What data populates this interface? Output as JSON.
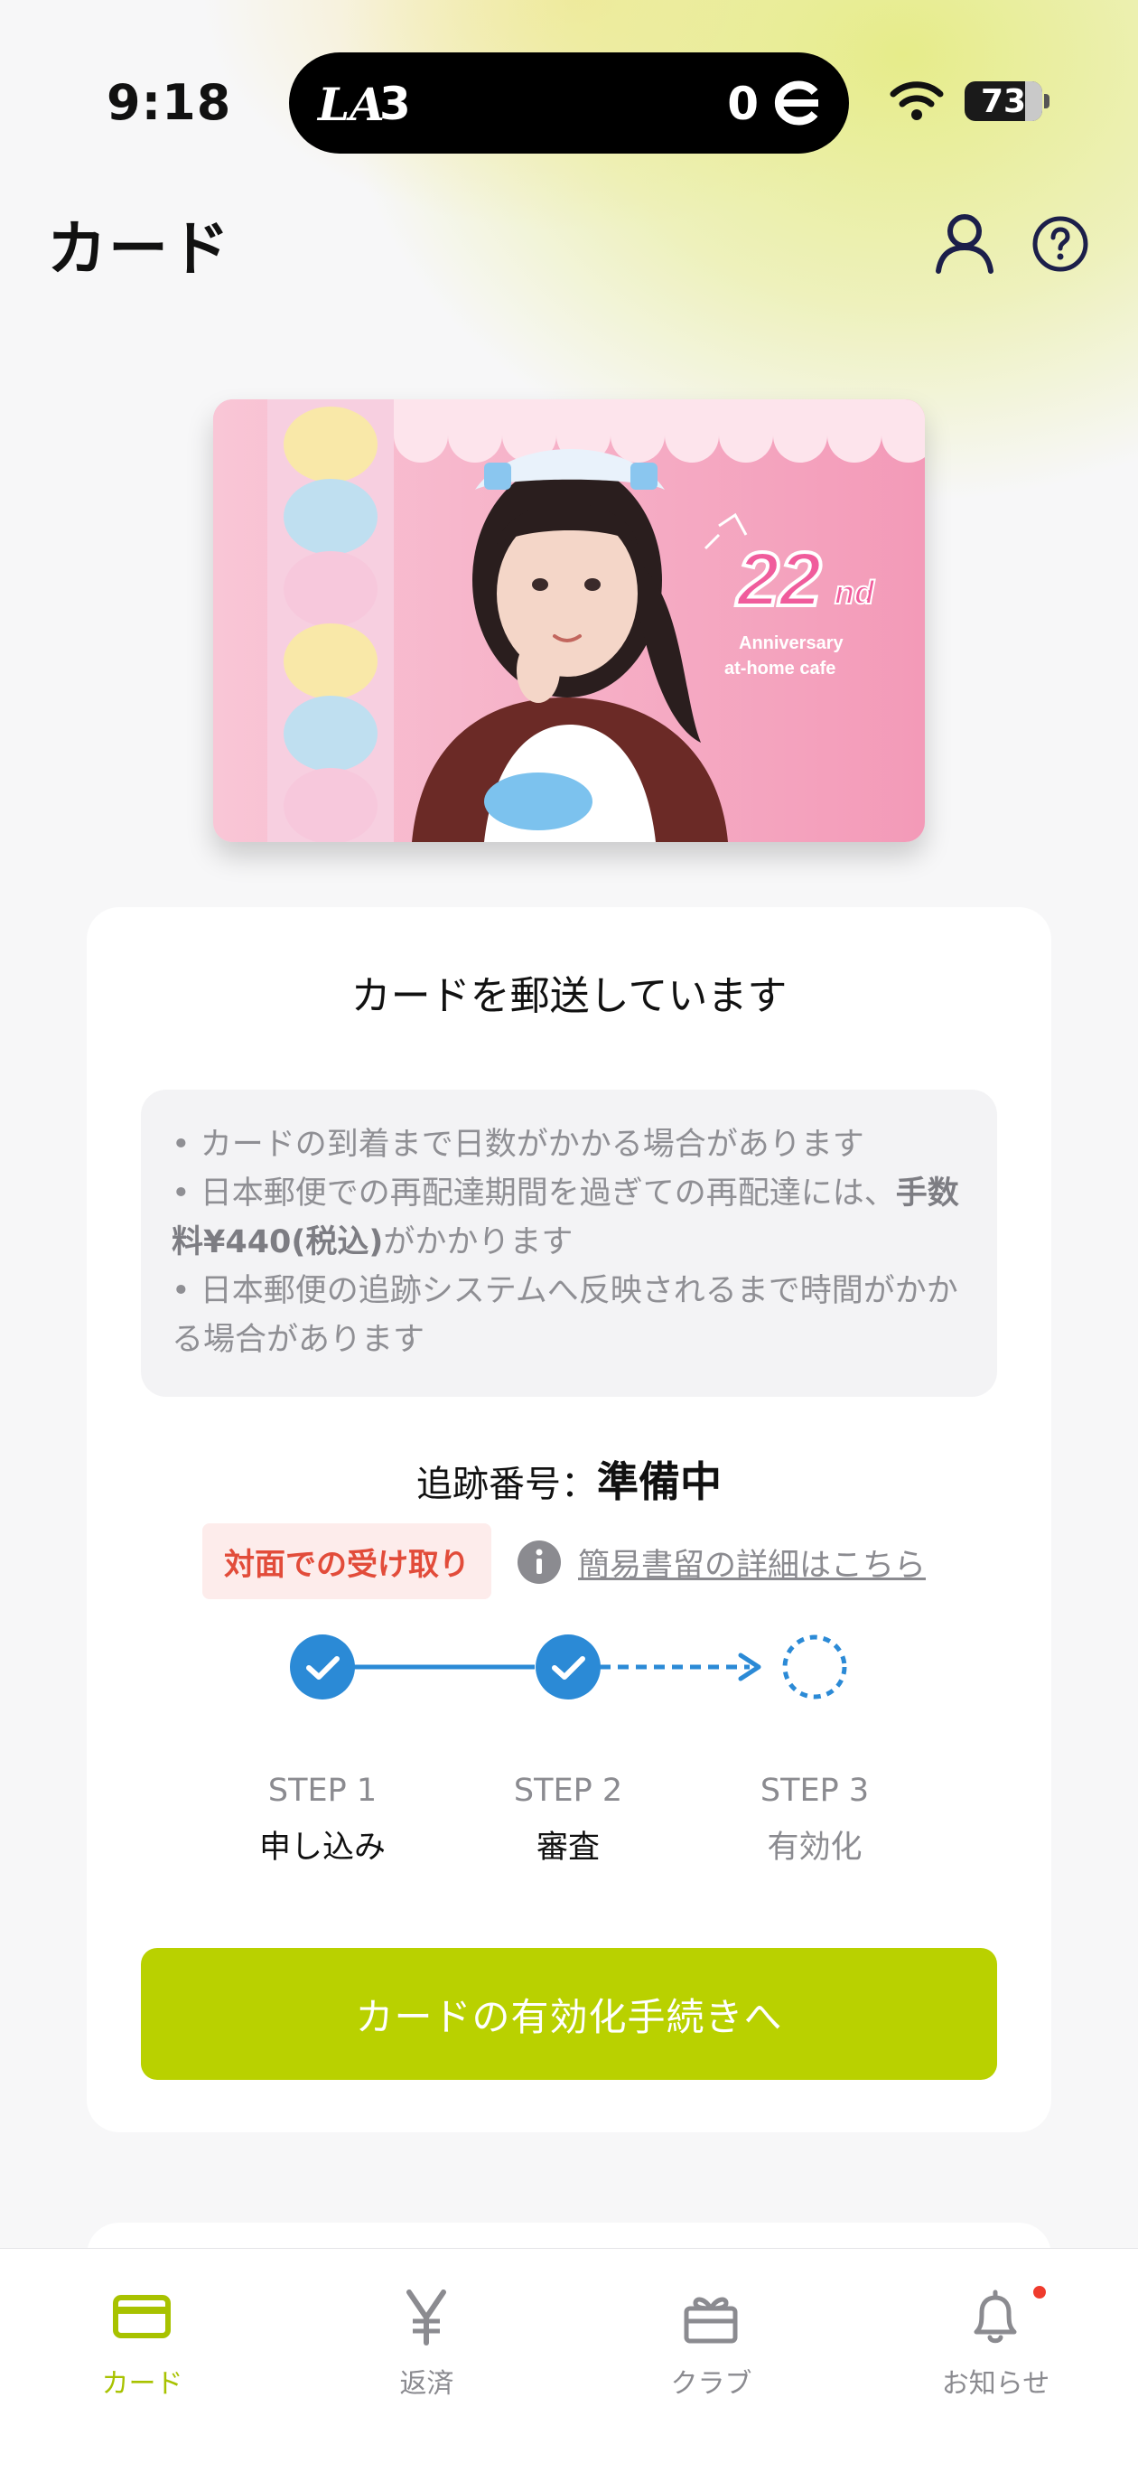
{
  "status_bar": {
    "time": "9:18",
    "live_activity": {
      "team_left": "LA",
      "score_left": "3",
      "score_right": "0",
      "team_right_icon": "reds-c-logo-icon"
    },
    "battery": "73"
  },
  "header": {
    "title": "カード",
    "account_icon": "user-icon",
    "help_icon": "help-circle-icon"
  },
  "card_image": {
    "badge_number": "22",
    "badge_suffix": "nd",
    "badge_line1": "Anniversary",
    "badge_line2": "at-home cafe"
  },
  "status_panel": {
    "title": "カードを郵送しています",
    "notices": {
      "line1": "• カードの到着まで日数がかかる場合があります",
      "line2_pre": "• 日本郵便での再配達期間を過ぎての再配達には、",
      "line2_bold": "手数料¥440(税込)",
      "line2_post": "がかかります",
      "line3": "• 日本郵便の追跡システムへ反映されるまで時間がかかる場合があります"
    },
    "tracking_label": "追跡番号：",
    "tracking_value": "準備中",
    "pickup_badge": "対面での受け取り",
    "info_link": "簡易書留の詳細はこちら",
    "steps": [
      {
        "number": "STEP 1",
        "label": "申し込み",
        "done": true
      },
      {
        "number": "STEP 2",
        "label": "審査",
        "done": true
      },
      {
        "number": "STEP 3",
        "label": "有効化",
        "done": false
      }
    ],
    "accent_color": "#2b8ad6",
    "activate_button": "カードの有効化手続きへ",
    "button_color": "#b9d100"
  },
  "tabbar": {
    "items": [
      {
        "label": "カード",
        "icon": "card-icon",
        "active": true
      },
      {
        "label": "返済",
        "icon": "yen-icon",
        "active": false
      },
      {
        "label": "クラブ",
        "icon": "gift-icon",
        "active": false
      },
      {
        "label": "お知らせ",
        "icon": "bell-icon",
        "active": false,
        "has_notification": true
      }
    ]
  }
}
